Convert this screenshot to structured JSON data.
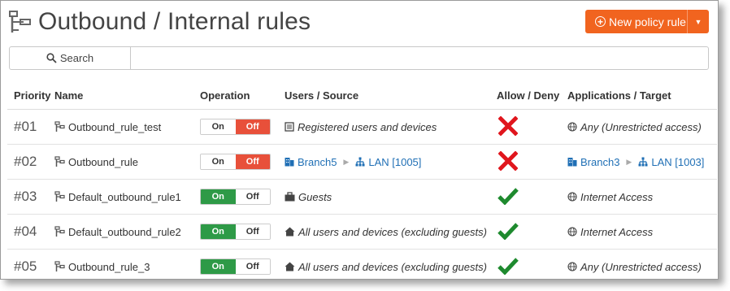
{
  "header": {
    "title": "Outbound / Internal rules",
    "new_button": "New policy rule"
  },
  "search": {
    "button_label": "Search",
    "placeholder": ""
  },
  "columns": {
    "priority": "Priority",
    "name": "Name",
    "operation": "Operation",
    "users": "Users / Source",
    "allow": "Allow / Deny",
    "apps": "Applications / Target"
  },
  "toggle": {
    "on": "On",
    "off": "Off"
  },
  "rows": [
    {
      "priority": "#01",
      "name": "Outbound_rule_test",
      "state": "off",
      "source_icon": "list-icon",
      "source": "Registered users and devices",
      "action": "deny",
      "target": "Any (Unrestricted access)"
    },
    {
      "priority": "#02",
      "name": "Outbound_rule",
      "state": "off",
      "source_a": "Branch5",
      "source_b": "LAN [1005]",
      "action": "deny",
      "target_a": "Branch3",
      "target_b": "LAN [1003]"
    },
    {
      "priority": "#03",
      "name": "Default_outbound_rule1",
      "state": "on",
      "source_icon": "briefcase-icon",
      "source": "Guests",
      "action": "allow",
      "target": "Internet Access"
    },
    {
      "priority": "#04",
      "name": "Default_outbound_rule2",
      "state": "on",
      "source_icon": "home-icon",
      "source": "All users and devices (excluding guests)",
      "action": "allow",
      "target": "Internet Access"
    },
    {
      "priority": "#05",
      "name": "Outbound_rule_3",
      "state": "on",
      "source_icon": "home-icon",
      "source": "All users and devices (excluding guests)",
      "action": "allow",
      "target": "Any (Unrestricted access)"
    }
  ],
  "colors": {
    "accent": "#f1641f",
    "deny": "#e0161d",
    "allow": "#1e8a2e",
    "link": "#1f6fb5"
  }
}
